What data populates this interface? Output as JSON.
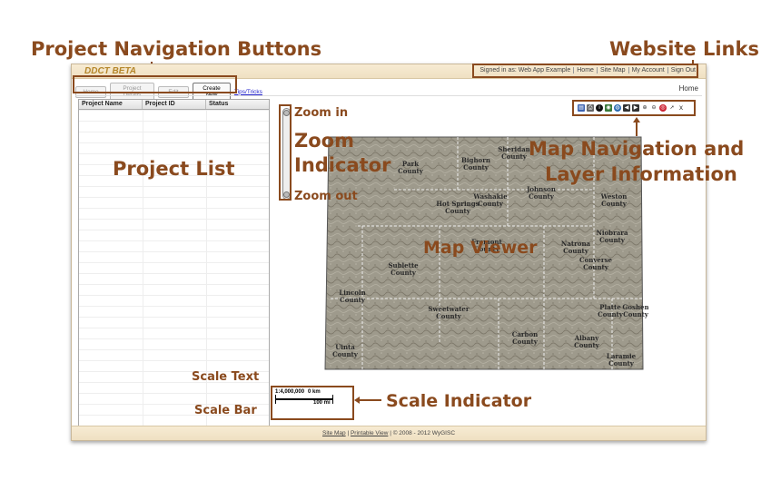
{
  "annotations": {
    "project_nav_buttons": "Project Navigation Buttons",
    "website_links": "Website Links",
    "project_list": "Project List",
    "zoom_in": "Zoom in",
    "zoom_indicator_line1": "Zoom",
    "zoom_indicator_line2": "Indicator",
    "zoom_out": "Zoom out",
    "map_nav_line1": "Map Navigation and",
    "map_nav_line2": "Layer Information",
    "map_viewer": "Map Viewer",
    "scale_text": "Scale Text",
    "scale_bar": "Scale Bar",
    "scale_indicator": "Scale Indicator"
  },
  "app": {
    "title": "DDCT BETA",
    "site_links": {
      "signed_in": "Signed in as: Web App Example",
      "home": "Home",
      "site_map": "Site Map",
      "my_account": "My Account",
      "sign_out": "Sign Out"
    },
    "toolbar": {
      "home": "Home",
      "project_details": "Project Details",
      "edit": "Edit",
      "create_new": "Create New",
      "tips": "Tips/Tricks"
    },
    "breadcrumb": "Home",
    "project_list": {
      "columns": [
        "Project Name",
        "Project ID",
        "Status"
      ]
    },
    "scale": {
      "ratio": "1:4,000,000",
      "km": "0 km",
      "mi": "100 mi"
    },
    "footer": {
      "site_map": "Site Map",
      "printable_view": "Printable View",
      "copyright": "| © 2008 - 2012 WyGISC"
    }
  },
  "map_labels": [
    {
      "name": "Sheridan",
      "sub": "County"
    },
    {
      "name": "Park",
      "sub": "County"
    },
    {
      "name": "Bighorn",
      "sub": "County"
    },
    {
      "name": "Johnson",
      "sub": "County"
    },
    {
      "name": "Washakie",
      "sub": "County"
    },
    {
      "name": "Hot Springs",
      "sub": "County"
    },
    {
      "name": "Weston",
      "sub": "County"
    },
    {
      "name": "Fremont",
      "sub": "County"
    },
    {
      "name": "Natrona",
      "sub": "County"
    },
    {
      "name": "Converse",
      "sub": "County"
    },
    {
      "name": "Niobrara",
      "sub": "County"
    },
    {
      "name": "Sublette",
      "sub": "County"
    },
    {
      "name": "Platte",
      "sub": "County"
    },
    {
      "name": "Goshen",
      "sub": "County"
    },
    {
      "name": "Lincoln",
      "sub": "County"
    },
    {
      "name": "Sweetwater",
      "sub": "County"
    },
    {
      "name": "Carbon",
      "sub": "County"
    },
    {
      "name": "Albany",
      "sub": "County"
    },
    {
      "name": "Laramie",
      "sub": "County"
    },
    {
      "name": "Uinta",
      "sub": "County"
    }
  ]
}
